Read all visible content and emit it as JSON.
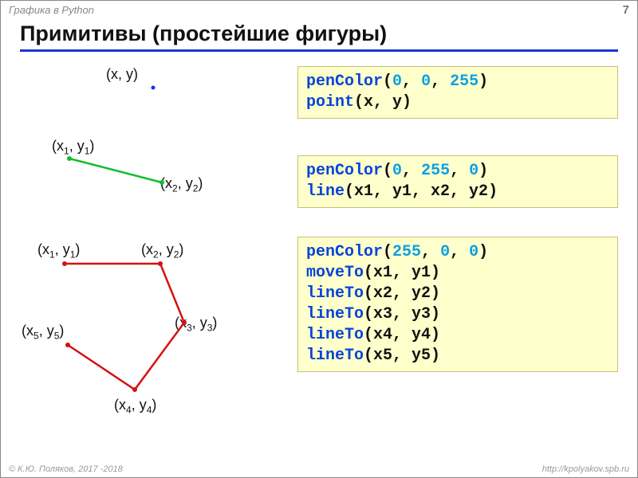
{
  "header": {
    "topic": "Графика в Python",
    "page": "7"
  },
  "title": "Примитивы (простейшие фигуры)",
  "footer": {
    "left": "© К.Ю. Поляков, 2017 -2018",
    "right": "http://kpolyakov.spb.ru"
  },
  "point": {
    "label": "(x, y)",
    "code": {
      "fn1": "penColor",
      "args1_a": "0",
      "args1_b": "0",
      "args1_c": "255",
      "fn2": "point",
      "args2": "x, y"
    }
  },
  "line": {
    "label1_pre": "(x",
    "label1_sub": "1",
    "label1_mid": ", y",
    "label1_sub2": "1",
    "label1_post": ")",
    "label2_pre": "(x",
    "label2_sub": "2",
    "label2_mid": ", y",
    "label2_sub2": "2",
    "label2_post": ")",
    "code": {
      "fn1": "penColor",
      "args1_a": "0",
      "args1_b": "255",
      "args1_c": "0",
      "fn2": "line",
      "args2": "x1, y1, x2, y2"
    }
  },
  "poly": {
    "labels": {
      "p1_pre": "(x",
      "p1_s": "1",
      "p1_mid": ", y",
      "p1_s2": "1",
      "p1_post": ")",
      "p2_pre": "(x",
      "p2_s": "2",
      "p2_mid": ", y",
      "p2_s2": "2",
      "p2_post": ")",
      "p3_pre": "(x",
      "p3_s": "3",
      "p3_mid": ", y",
      "p3_s2": "3",
      "p3_post": ")",
      "p4_pre": "(x",
      "p4_s": "4",
      "p4_mid": ", y",
      "p4_s2": "4",
      "p4_post": ")",
      "p5_pre": "(x",
      "p5_s": "5",
      "p5_mid": ", y",
      "p5_s2": "5",
      "p5_post": ")"
    },
    "code": {
      "fn1": "penColor",
      "args1_a": "255",
      "args1_b": "0",
      "args1_c": "0",
      "fn2": "moveTo",
      "args2": "x1, y1",
      "fn3": "lineTo",
      "args3": "x2, y2",
      "fn4": "lineTo",
      "args4": "x3, y3",
      "fn5": "lineTo",
      "args5": "x4, y4",
      "fn6": "lineTo",
      "args6": "x5, y5"
    }
  }
}
